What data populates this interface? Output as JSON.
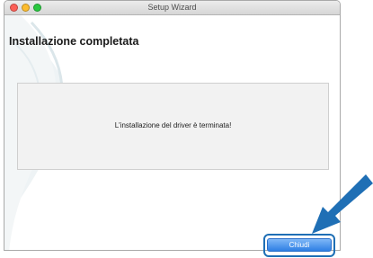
{
  "window": {
    "title": "Setup Wizard",
    "traffic_lights": [
      "close",
      "minimize",
      "zoom"
    ]
  },
  "main": {
    "heading": "Installazione completata",
    "message": "L'installazione del driver è terminata!"
  },
  "buttons": {
    "close_label": "Chiudi"
  },
  "colors": {
    "button_blue": "#2e7fe4",
    "highlight_blue": "#1f6fb5",
    "arrow_blue": "#1f6fb5"
  },
  "annotations": {
    "arrow_icon": "pointer-arrow-icon",
    "highlight": "button-highlight-frame"
  }
}
